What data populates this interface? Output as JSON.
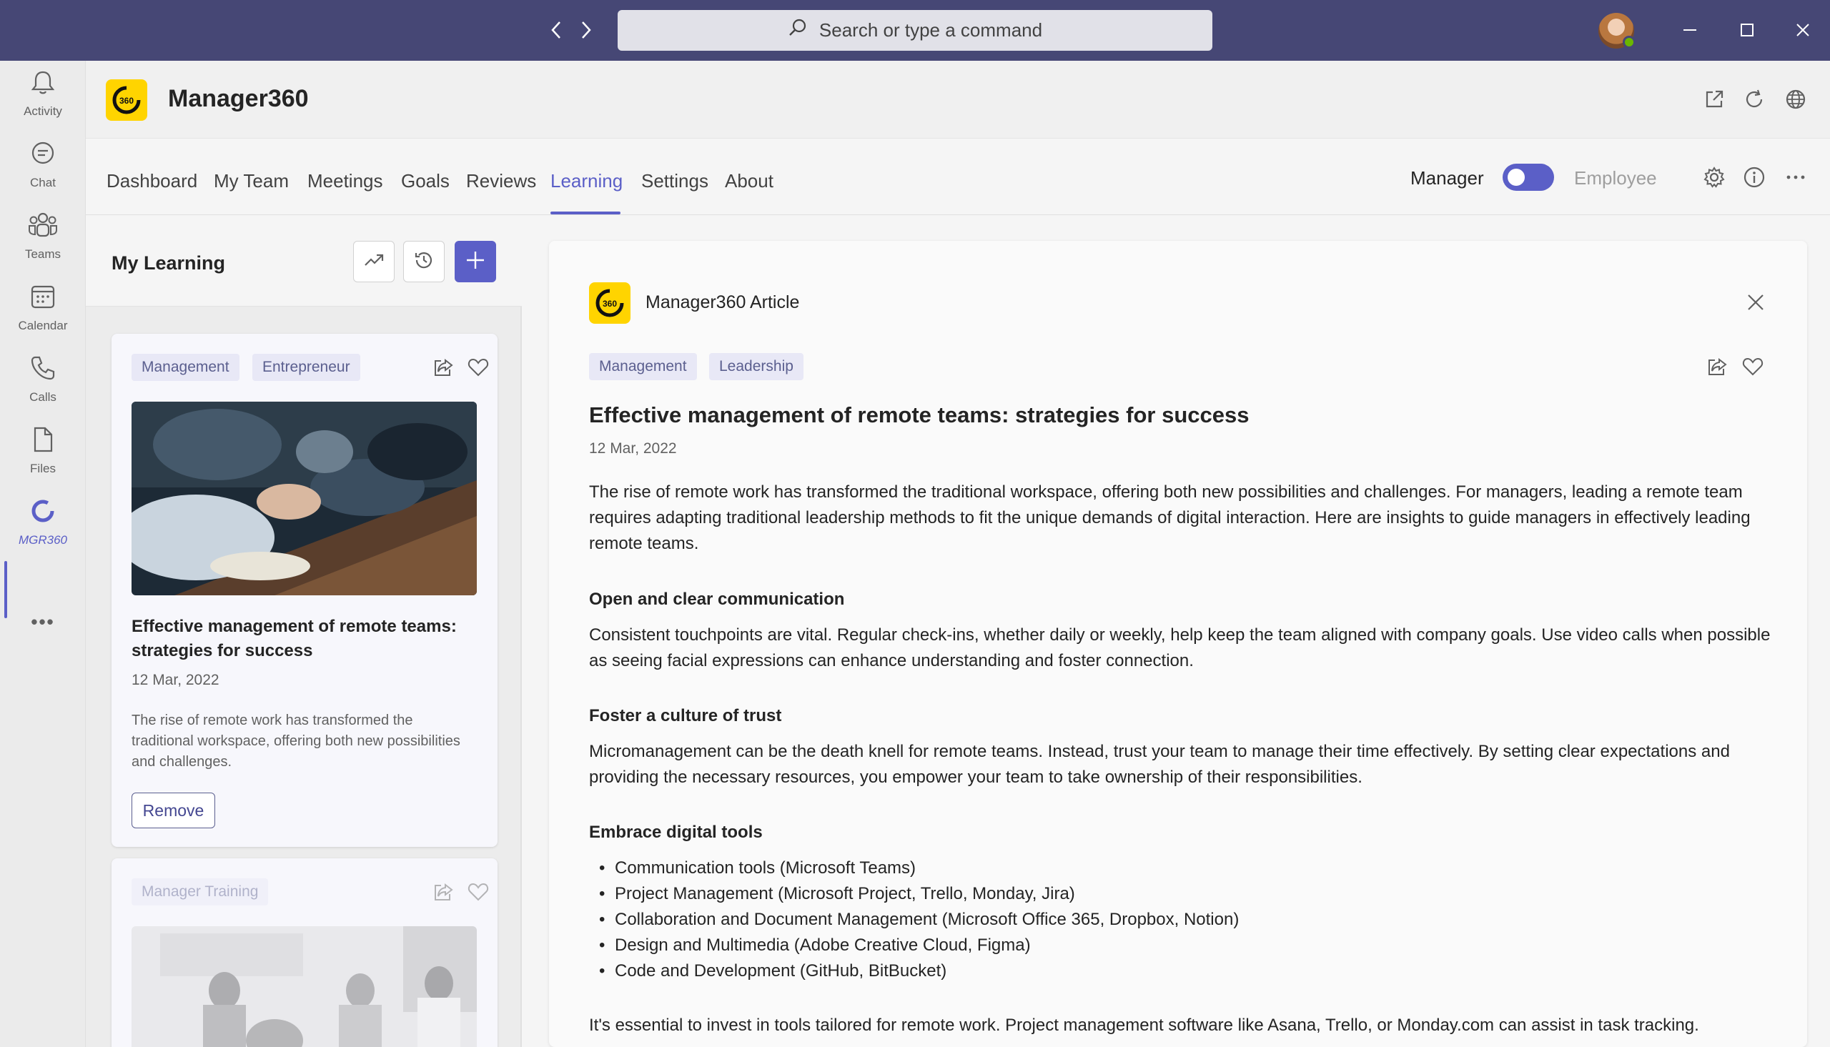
{
  "titlebar": {
    "search_placeholder": "Search or type a command"
  },
  "rail": {
    "items": [
      {
        "label": "Activity",
        "icon": "bell-icon"
      },
      {
        "label": "Chat",
        "icon": "chat-icon"
      },
      {
        "label": "Teams",
        "icon": "teams-icon"
      },
      {
        "label": "Calendar",
        "icon": "calendar-icon"
      },
      {
        "label": "Calls",
        "icon": "phone-icon"
      },
      {
        "label": "Files",
        "icon": "file-icon"
      },
      {
        "label": "MGR360",
        "icon": "mgr360-icon"
      }
    ],
    "more": "•••"
  },
  "app": {
    "title": "Manager360",
    "logo_text": "360"
  },
  "tabs": [
    "Dashboard",
    "My Team",
    "Meetings",
    "Goals",
    "Reviews",
    "Learning",
    "Settings",
    "About"
  ],
  "active_tab": "Learning",
  "role": {
    "manager": "Manager",
    "employee": "Employee",
    "active": "Manager"
  },
  "learning": {
    "title": "My Learning",
    "cards": [
      {
        "tags": [
          "Management",
          "Entrepreneur"
        ],
        "title": "Effective management of remote teams: strategies for success",
        "date": "12 Mar, 2022",
        "excerpt": "The rise of remote work has transformed the traditional workspace, offering both new possibilities and challenges.",
        "remove_label": "Remove"
      },
      {
        "tags": [
          "Manager Training"
        ]
      }
    ]
  },
  "article": {
    "source": "Manager360 Article",
    "tags": [
      "Management",
      "Leadership"
    ],
    "title": "Effective management of remote teams: strategies for success",
    "date": "12 Mar, 2022",
    "intro": "The rise of remote work has transformed the traditional workspace, offering both new possibilities and challenges. For managers, leading a remote team requires adapting traditional leadership methods to fit the unique demands of digital interaction. Here are insights to guide managers in effectively leading remote teams.",
    "sections": [
      {
        "heading": "Open and clear communication",
        "body": "Consistent touchpoints are vital. Regular check-ins, whether daily or weekly, help keep the team aligned with company goals. Use video calls when possible as seeing facial expressions can enhance understanding and foster connection."
      },
      {
        "heading": "Foster a culture of trust",
        "body": "Micromanagement can be the death knell for remote teams. Instead, trust your team to manage their time effectively. By setting clear expectations and providing the necessary resources, you empower your team to take ownership of their responsibilities."
      },
      {
        "heading": "Embrace digital tools"
      }
    ],
    "tools": [
      "Communication tools (Microsoft Teams)",
      "Project Management (Microsoft Project, Trello, Monday, Jira)",
      "Collaboration and Document Management (Microsoft Office 365, Dropbox, Notion)",
      "Design and Multimedia (Adobe Creative Cloud, Figma)",
      "Code and Development (GitHub, BitBucket)"
    ],
    "closing": "It's essential to invest in tools tailored for remote work. Project management software like Asana, Trello, or Monday.com can assist in task tracking."
  },
  "colors": {
    "titlebar": "#464775",
    "accent": "#5b5fc7",
    "logo": "#ffd400"
  }
}
